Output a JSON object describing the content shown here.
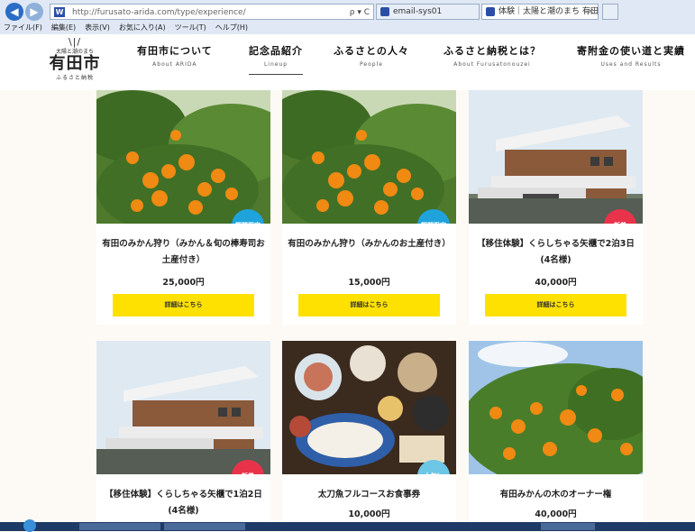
{
  "browser": {
    "url": "http://furusato-arida.com/type/experience/",
    "address_tools": "ρ ▾ C",
    "tabs": [
      {
        "label": "email-sys01"
      },
      {
        "label": "体験｜太陽と潮のまち 有田...",
        "close": "×"
      }
    ],
    "menu": [
      "ファイル(F)",
      "編集(E)",
      "表示(V)",
      "お気に入り(A)",
      "ツール(T)",
      "ヘルプ(H)"
    ]
  },
  "site": {
    "logo": {
      "rays": "\\|/",
      "tagline": "太陽と潮のまち",
      "name": "有田市",
      "sub": "ふるさと納税"
    },
    "nav": [
      {
        "jp": "有田市について",
        "en": "About ARIDA"
      },
      {
        "jp": "記念品紹介",
        "en": "Lineup"
      },
      {
        "jp": "ふるさとの人々",
        "en": "People"
      },
      {
        "jp": "ふるさと納税とは？",
        "en": "About Furusatonouzei"
      },
      {
        "jp": "寄附金の使い道と実績",
        "en": "Uses and Results"
      }
    ]
  },
  "products": [
    {
      "title": "有田のみかん狩り（みかん＆旬の棒寿司お土産付き）",
      "price": "25,000円",
      "badge": "期間限定",
      "button": "詳細はこちら"
    },
    {
      "title": "有田のみかん狩り（みかんのお土産付き）",
      "price": "15,000円",
      "badge": "期間限定",
      "button": "詳細はこちら"
    },
    {
      "title": "【移住体験】くらしちゃる矢櫃で2泊3日(4名様)",
      "price": "40,000円",
      "badge": "新着",
      "button": "詳細はこちら"
    },
    {
      "title": "【移住体験】くらしちゃる矢櫃で1泊2日(4名様)",
      "price": "",
      "badge": "新着"
    },
    {
      "title": "太刀魚フルコースお食事券",
      "price": "10,000円",
      "badge": "人気！"
    },
    {
      "title": "有田みかんの木のオーナー権",
      "price": "40,000円",
      "badge": ""
    }
  ],
  "colors": {
    "button_yellow": "#ffe100",
    "badge_blue": "#1fa3dc",
    "badge_red": "#e8334a",
    "badge_light_blue": "#6cc6e6",
    "page_bg": "#fdfaf5"
  }
}
